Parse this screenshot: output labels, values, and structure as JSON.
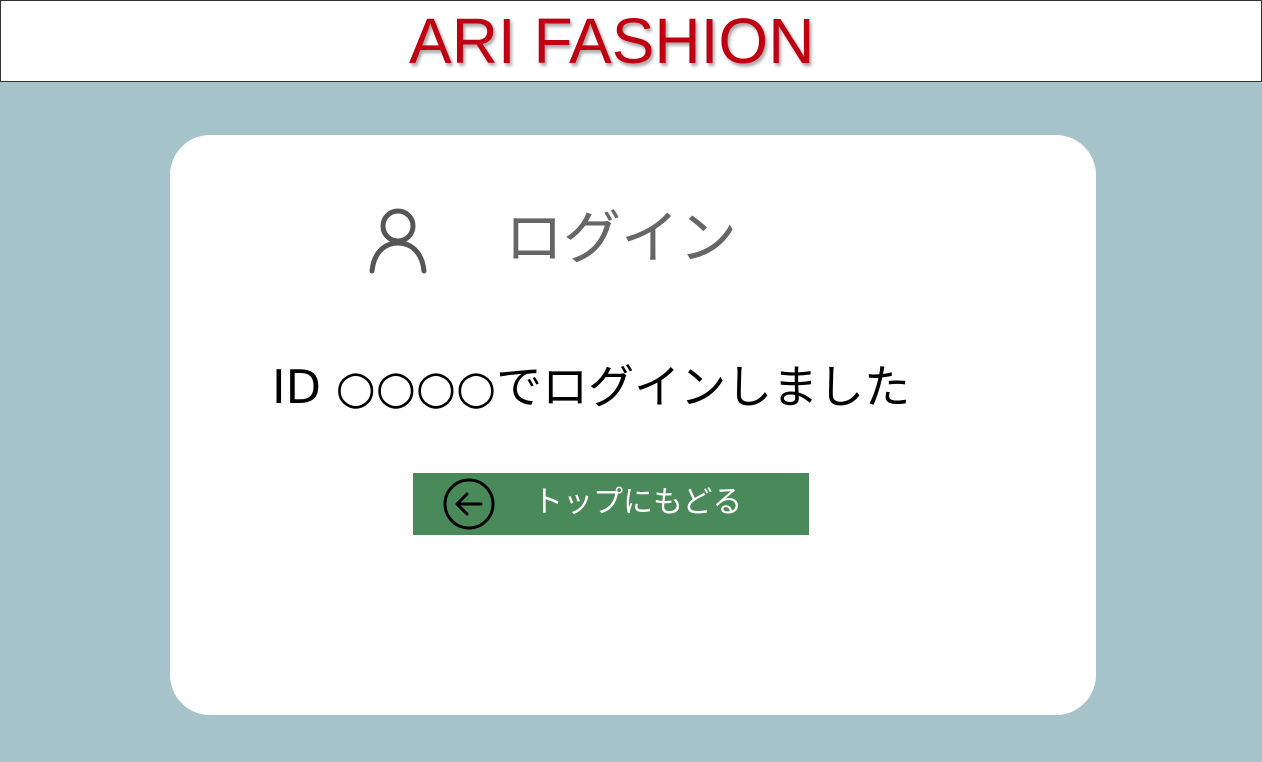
{
  "header": {
    "brand": "ARI FASHION"
  },
  "card": {
    "title": "ログイン",
    "title_icon": "user-icon",
    "message": "ID ○○○○でログインしました",
    "back_button": {
      "label": "トップにもどる",
      "icon": "arrow-left-circle-icon"
    }
  },
  "colors": {
    "brand": "#c00012",
    "background": "#a5c3c9",
    "card": "#ffffff",
    "button": "#4a8a5a",
    "title_text": "#666666"
  }
}
